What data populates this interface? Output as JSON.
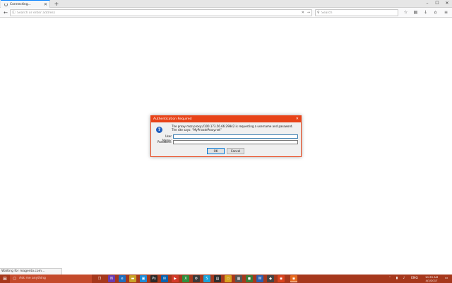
{
  "browser": {
    "tab_title": "Connecting...",
    "url_placeholder": "Search or enter address",
    "search_placeholder": "Search"
  },
  "dialog": {
    "title": "Authentication Required",
    "message": "The proxy moz-proxy://100.173.56.66:29842 is requesting a username and password. The site says: “MyPrivateProxy.net”",
    "username_label": "User Name:",
    "password_label": "Password:",
    "ok_label": "OK",
    "cancel_label": "Cancel"
  },
  "status": {
    "text": "Waiting for magento.com..."
  },
  "taskbar": {
    "search_placeholder": "Ask me anything",
    "language": "ENG",
    "time": "10:33 AM",
    "date": "4/3/2017"
  },
  "colors": {
    "dialog_accent": "#e84318",
    "taskbar": "#a6381c"
  }
}
